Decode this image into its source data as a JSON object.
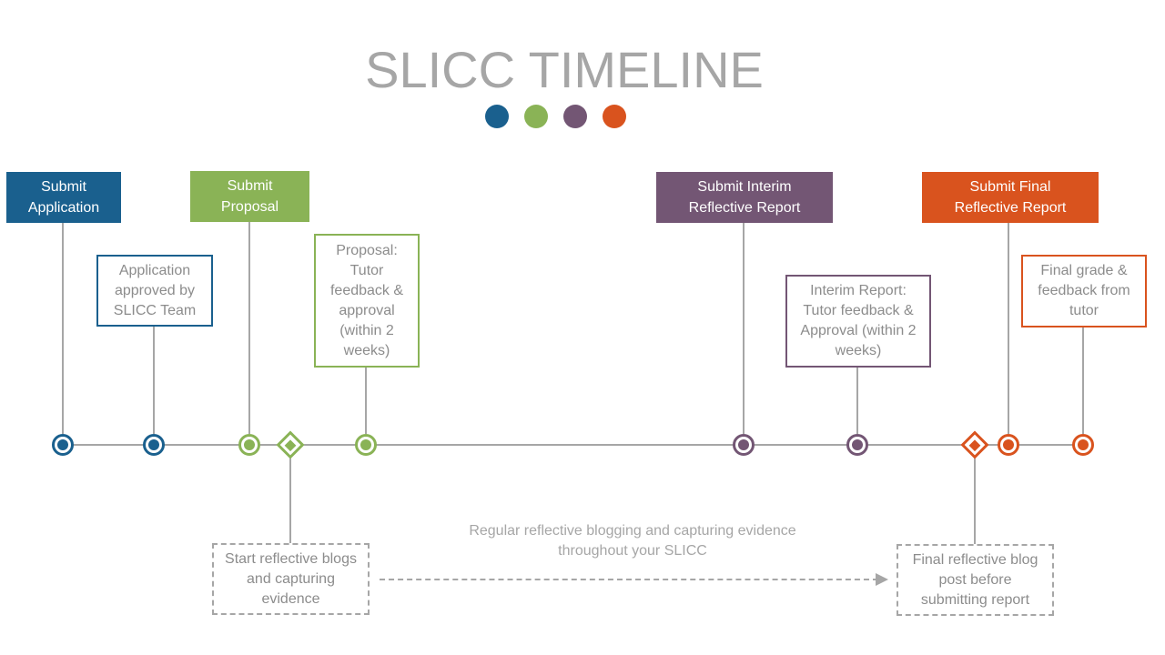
{
  "title": "SLICC TIMELINE",
  "colors": {
    "blue": "#1a608e",
    "green": "#8ab356",
    "purple": "#735674",
    "orange": "#d9531e",
    "gray": "#a6a6a6"
  },
  "milestones_top": [
    {
      "label": "Submit Application",
      "color": "blue"
    },
    {
      "label": "Submit Proposal",
      "color": "green"
    },
    {
      "label": "Submit Interim Reflective Report",
      "color": "purple"
    },
    {
      "label": "Submit Final Reflective Report",
      "color": "orange"
    }
  ],
  "feedback_boxes": [
    {
      "label": "Application approved by SLICC Team",
      "color": "blue"
    },
    {
      "label": "Proposal: Tutor feedback & approval (within 2 weeks)",
      "color": "green"
    },
    {
      "label": "Interim Report: Tutor feedback & Approval (within 2 weeks)",
      "color": "purple"
    },
    {
      "label": "Final grade & feedback from tutor",
      "color": "orange"
    }
  ],
  "blog_boxes": [
    {
      "label": "Start reflective blogs and capturing evidence"
    },
    {
      "label": "Final reflective blog post before submitting report"
    }
  ],
  "blog_note": "Regular reflective blogging and capturing evidence throughout your SLICC"
}
